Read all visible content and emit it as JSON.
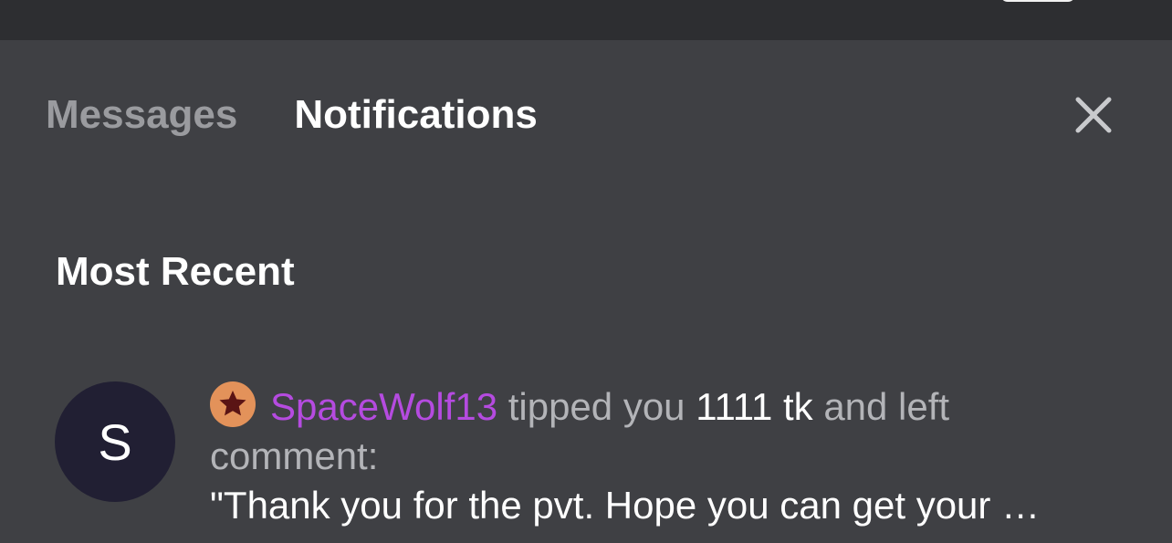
{
  "tabs": [
    {
      "label": "Messages",
      "active": false
    },
    {
      "label": "Notifications",
      "active": true
    }
  ],
  "close_icon": "close-icon",
  "section": {
    "title": "Most Recent"
  },
  "notification": {
    "avatar_letter": "S",
    "badge_icon": "star-icon",
    "username": "SpaceWolf13",
    "text_tipped": "tipped you",
    "amount": "1111 tk",
    "text_left": "and left",
    "text_comment": "comment:",
    "quote": "\"Thank you for the pvt. Hope you can get your …"
  },
  "colors": {
    "background": "#3f4044",
    "topbar": "#2d2e31",
    "username": "#b54be0",
    "badge": "#e3925a",
    "badge_star": "#5a1414",
    "avatar": "#211f33"
  }
}
